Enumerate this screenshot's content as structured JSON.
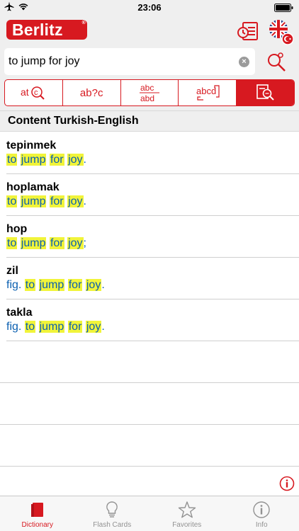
{
  "status_bar": {
    "time": "23:06"
  },
  "header": {
    "logo_text": "Berlitz",
    "logo_mark": "®"
  },
  "search": {
    "value": "to jump for joy",
    "clear_symbol": "×"
  },
  "modes": [
    {
      "label": "atⓒ",
      "icon": "spell-check-icon"
    },
    {
      "label": "ab?c",
      "icon": "wildcard-icon"
    },
    {
      "label": "abc/abd",
      "icon": "compare-icon"
    },
    {
      "label": "abcd",
      "icon": "anagram-icon"
    },
    {
      "label": "",
      "icon": "fulltext-search-icon"
    }
  ],
  "section": {
    "title": "Content Turkish-English"
  },
  "results": [
    {
      "headword": "tepinmek",
      "prefix": "",
      "words": [
        "to",
        "jump",
        "for",
        "joy"
      ],
      "suffix": "."
    },
    {
      "headword": "hoplamak",
      "prefix": "",
      "words": [
        "to",
        "jump",
        "for",
        "joy"
      ],
      "suffix": "."
    },
    {
      "headword": "hop",
      "prefix": "",
      "words": [
        "to",
        "jump",
        "for",
        "joy"
      ],
      "suffix": ";"
    },
    {
      "headword": "zil",
      "prefix": "fig.",
      "words": [
        "to",
        "jump",
        "for",
        "joy"
      ],
      "suffix": "."
    },
    {
      "headword": "takla",
      "prefix": "fig.",
      "words": [
        "to",
        "jump",
        "for",
        "joy"
      ],
      "suffix": "."
    }
  ],
  "tabs": [
    {
      "label": "Dictionary",
      "icon": "book-icon",
      "active": true
    },
    {
      "label": "Flash Cards",
      "icon": "lightbulb-icon",
      "active": false
    },
    {
      "label": "Favorites",
      "icon": "star-icon",
      "active": false
    },
    {
      "label": "Info",
      "icon": "info-icon",
      "active": false
    }
  ],
  "colors": {
    "accent": "#d71920",
    "link": "#0a5fb0",
    "highlight": "#f1f43a",
    "bar_bg": "#efefef"
  }
}
